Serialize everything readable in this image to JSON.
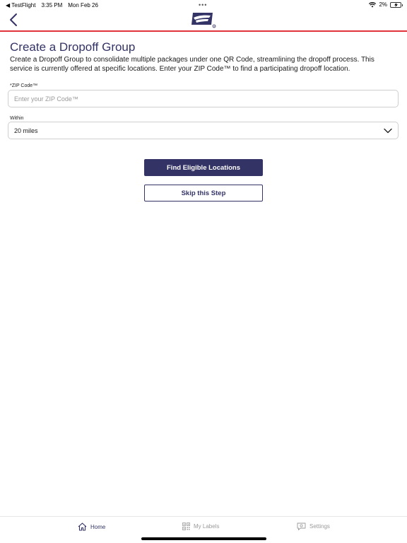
{
  "status_bar": {
    "back_app": "◀ TestFlight",
    "time": "3:35 PM",
    "date": "Mon Feb 26",
    "dots": "•••",
    "battery_percent": "2%"
  },
  "header": {
    "back_icon": "chevron-left-icon",
    "logo_icon": "usps-eagle-logo",
    "accent_color": "#e0333c"
  },
  "main": {
    "title": "Create a Dropoff Group",
    "description": "Create a Dropoff Group to consolidate multiple packages under one QR Code, streamlining the dropoff process. This service is currently offered at specific locations. Enter your ZIP Code™ to find a participating dropoff location.",
    "zip": {
      "label": "*ZIP Code™",
      "placeholder": "Enter your ZIP Code™",
      "value": ""
    },
    "within": {
      "label": "Within",
      "selected": "20 miles"
    },
    "find_button": "Find Eligible Locations",
    "skip_button": "Skip this Step",
    "brand_color": "#333366"
  },
  "tab_bar": {
    "tabs": [
      {
        "label": "Home",
        "icon": "home-icon",
        "active": true
      },
      {
        "label": "My Labels",
        "icon": "qr-code-icon",
        "active": false
      },
      {
        "label": "Settings",
        "icon": "settings-chat-icon",
        "active": false
      }
    ]
  }
}
